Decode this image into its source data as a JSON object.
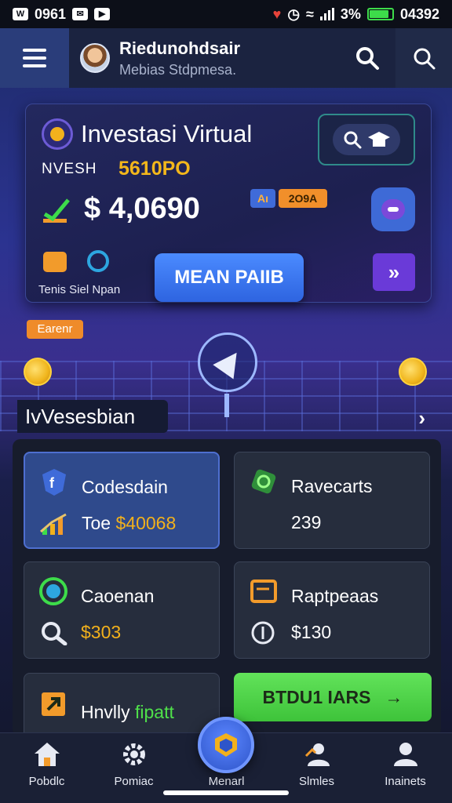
{
  "status_bar": {
    "left_text": "0961",
    "battery_percent": "3%",
    "right_text": "04392"
  },
  "app_bar": {
    "title": "Riedunohdsair",
    "subtitle": "Mebias Stdpmesa.",
    "icons": [
      "menu-icon",
      "avatar",
      "search-icon",
      "search-icon"
    ]
  },
  "hero": {
    "title": "Investasi Virtual",
    "label": "NVESH",
    "label_value": "5610PO",
    "amount": "$ 4,0690",
    "chip_a": "Aı",
    "chip_b": "2O9A",
    "small_caption": "Tenis Siel Npan",
    "primary_button": "MEAN PAIIB",
    "next_button": "»"
  },
  "scene": {
    "tag": "Earenr"
  },
  "section": {
    "title": "IvVesesbian",
    "arrow": "›"
  },
  "tiles": [
    {
      "title": "Codesdain",
      "value_prefix": "Toe ",
      "value": "$40068",
      "icon": "shield-f-icon"
    },
    {
      "title": "Ravecarts",
      "value_prefix": "",
      "value": "239",
      "icon": "money-icon"
    },
    {
      "title": "Caoenan",
      "value_prefix": "",
      "value": "$303",
      "icon": "target-icon"
    },
    {
      "title": "Raptpeaas",
      "value_prefix": "",
      "value": "$130",
      "icon": "wallet-icon"
    },
    {
      "title_a": "Hnvlly ",
      "title_b": "fipatt",
      "icon": "arrow-box-icon"
    }
  ],
  "cta": {
    "label": "BTDU1 IARS",
    "arrow": "→"
  },
  "bottom_nav": [
    {
      "label": "Pobdlc",
      "icon": "home-icon"
    },
    {
      "label": "Pomiac",
      "icon": "gear-icon"
    },
    {
      "label": "Menarl",
      "icon": "center-badge-icon"
    },
    {
      "label": "Slmles",
      "icon": "people-icon"
    },
    {
      "label": "Inainets",
      "icon": "user-icon"
    }
  ],
  "colors": {
    "accent_blue": "#2e64e0",
    "gold": "#f2b11c",
    "green": "#4fe04a",
    "orange": "#ef8b2a",
    "purple": "#6a3ad8"
  }
}
